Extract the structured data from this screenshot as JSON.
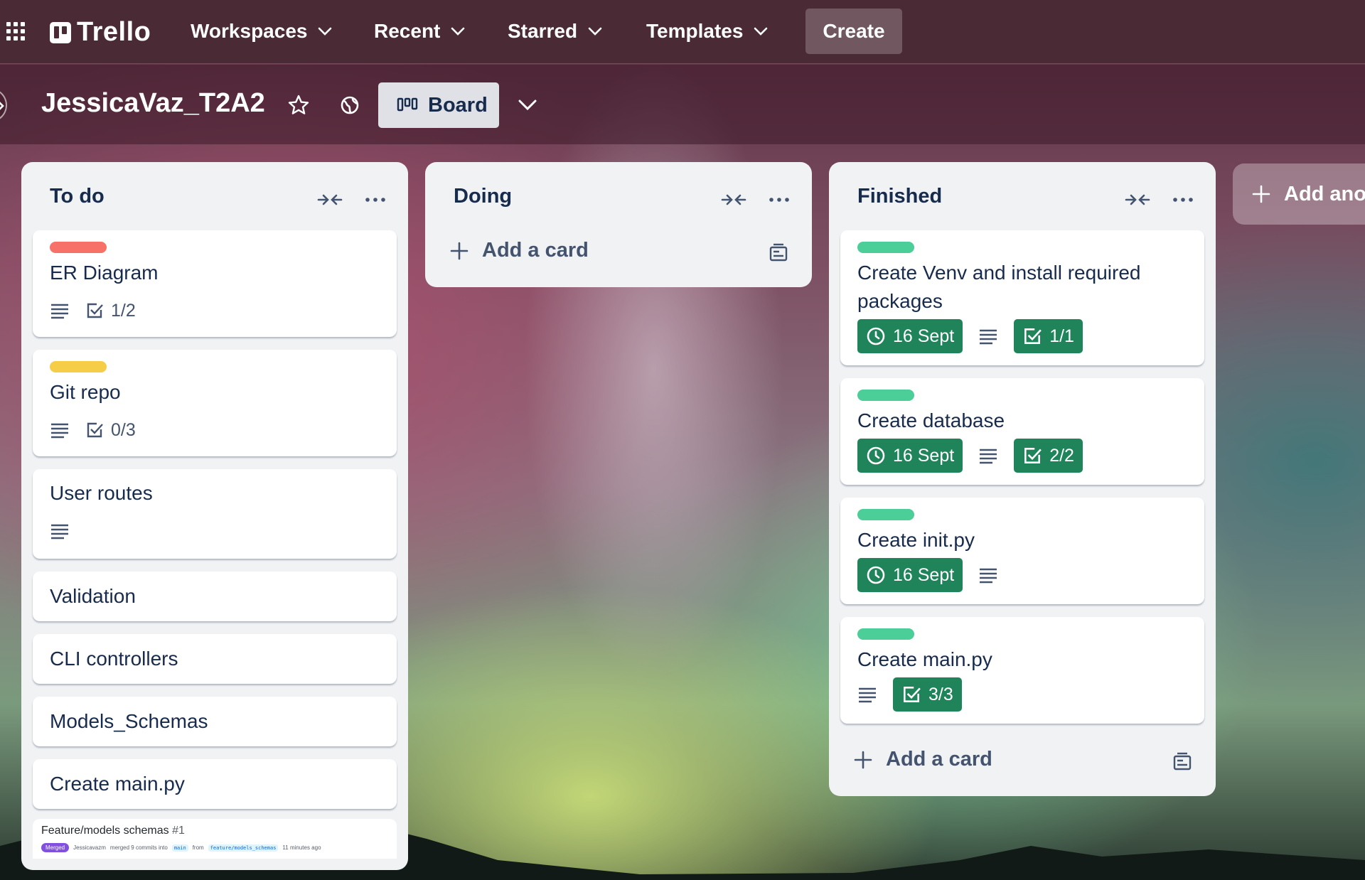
{
  "nav": {
    "logo_text": "Trello",
    "items": [
      {
        "label": "Workspaces"
      },
      {
        "label": "Recent"
      },
      {
        "label": "Starred"
      },
      {
        "label": "Templates"
      }
    ],
    "create_label": "Create"
  },
  "board": {
    "title": "JessicaVaz_T2A2",
    "view_label": "Board"
  },
  "lists": [
    {
      "title": "To do",
      "cards": [
        {
          "title": "ER Diagram",
          "label_color": "#f87168",
          "checklist": "1/2"
        },
        {
          "title": "Git repo",
          "label_color": "#f5cd47",
          "checklist": "0/3"
        },
        {
          "title": "User routes"
        },
        {
          "title": "Validation"
        },
        {
          "title": "CLI controllers"
        },
        {
          "title": "Models_Schemas"
        },
        {
          "title": "Create main.py"
        }
      ],
      "pr_card": {
        "title": "Feature/models schemas",
        "number": "#1",
        "status": "Merged",
        "author": "Jessicavazm",
        "merged_text": "merged 9 commits into",
        "base_branch": "main",
        "from_text": "from",
        "head_branch": "feature/models_schemas",
        "time": "11 minutes ago"
      }
    },
    {
      "title": "Doing",
      "add_card_label": "Add a card"
    },
    {
      "title": "Finished",
      "cards": [
        {
          "title": "Create Venv and install required packages",
          "label_color": "#4bce97",
          "due": "16 Sept",
          "checklist": "1/1"
        },
        {
          "title": "Create database",
          "label_color": "#4bce97",
          "due": "16 Sept",
          "checklist": "2/2"
        },
        {
          "title": "Create init.py",
          "label_color": "#4bce97",
          "due": "16 Sept"
        },
        {
          "title": "Create main.py",
          "label_color": "#4bce97",
          "checklist": "3/3"
        }
      ],
      "add_card_label": "Add a card"
    }
  ],
  "add_list_label": "Add anot",
  "colors": {
    "nav_bg": "#4a2a34",
    "list_bg": "#f1f2f4",
    "complete_green": "#1f845a"
  }
}
